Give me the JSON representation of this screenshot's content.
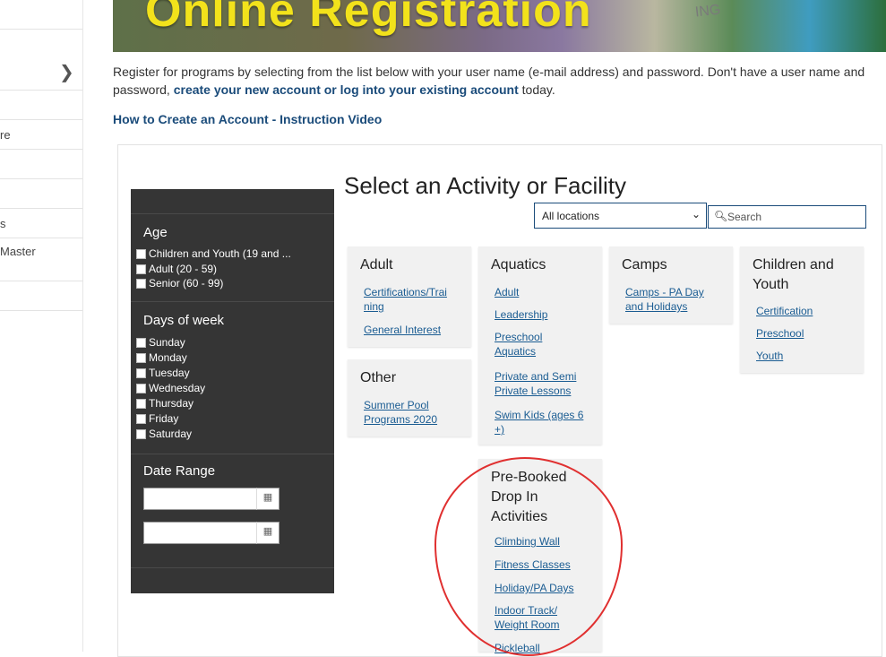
{
  "nav": {
    "item_re": "re",
    "item_s": "s",
    "item_master": "Master"
  },
  "banner": {
    "title": "Online Registration",
    "shirt_text": "ING"
  },
  "intro": {
    "text_before": "Register for programs by selecting from the list below with your user name (e-mail address) and password. Don't have a user name and password, ",
    "link": "create your new account or log into your existing account",
    "text_after": " today."
  },
  "howto_link": "How to Create an Account - Instruction Video",
  "filters": {
    "age_title": "Age",
    "age": [
      "Children and Youth (19 and ...",
      "Adult (20 - 59)",
      "Senior (60 - 99)"
    ],
    "days_title": "Days of week",
    "days": [
      "Sunday",
      "Monday",
      "Tuesday",
      "Wednesday",
      "Thursday",
      "Friday",
      "Saturday"
    ],
    "date_title": "Date Range"
  },
  "main": {
    "title": "Select an Activity or Facility",
    "location_value": "All locations",
    "search_placeholder": "Search"
  },
  "cards": {
    "adult": {
      "title": "Adult",
      "links": [
        "Certifications/Trai",
        "ning",
        "General Interest"
      ]
    },
    "other": {
      "title": "Other",
      "links": [
        "Summer Pool",
        "Programs 2020"
      ]
    },
    "aquatics": {
      "title": "Aquatics",
      "links": [
        "Adult",
        "Leadership",
        "Preschool",
        "Aquatics",
        "Private and Semi",
        "Private Lessons",
        "Swim Kids (ages 6",
        "+)"
      ]
    },
    "camps": {
      "title": "Camps",
      "links": [
        "Camps - PA Day",
        "and Holidays"
      ]
    },
    "children": {
      "title_l1": "Children and",
      "title_l2": "Youth",
      "links": [
        "Certification",
        "Preschool",
        "Youth"
      ]
    },
    "prebooked": {
      "title_l1": "Pre-Booked",
      "title_l2": "Drop In",
      "title_l3": "Activities",
      "links": [
        "Climbing Wall",
        "Fitness Classes",
        "Holiday/PA Days",
        "Indoor Track/",
        "Weight Room",
        "Pickleball"
      ]
    }
  },
  "colors": {
    "link": "#1a5c92",
    "sidebar_bg": "#353535",
    "annotation": "#e03030"
  }
}
